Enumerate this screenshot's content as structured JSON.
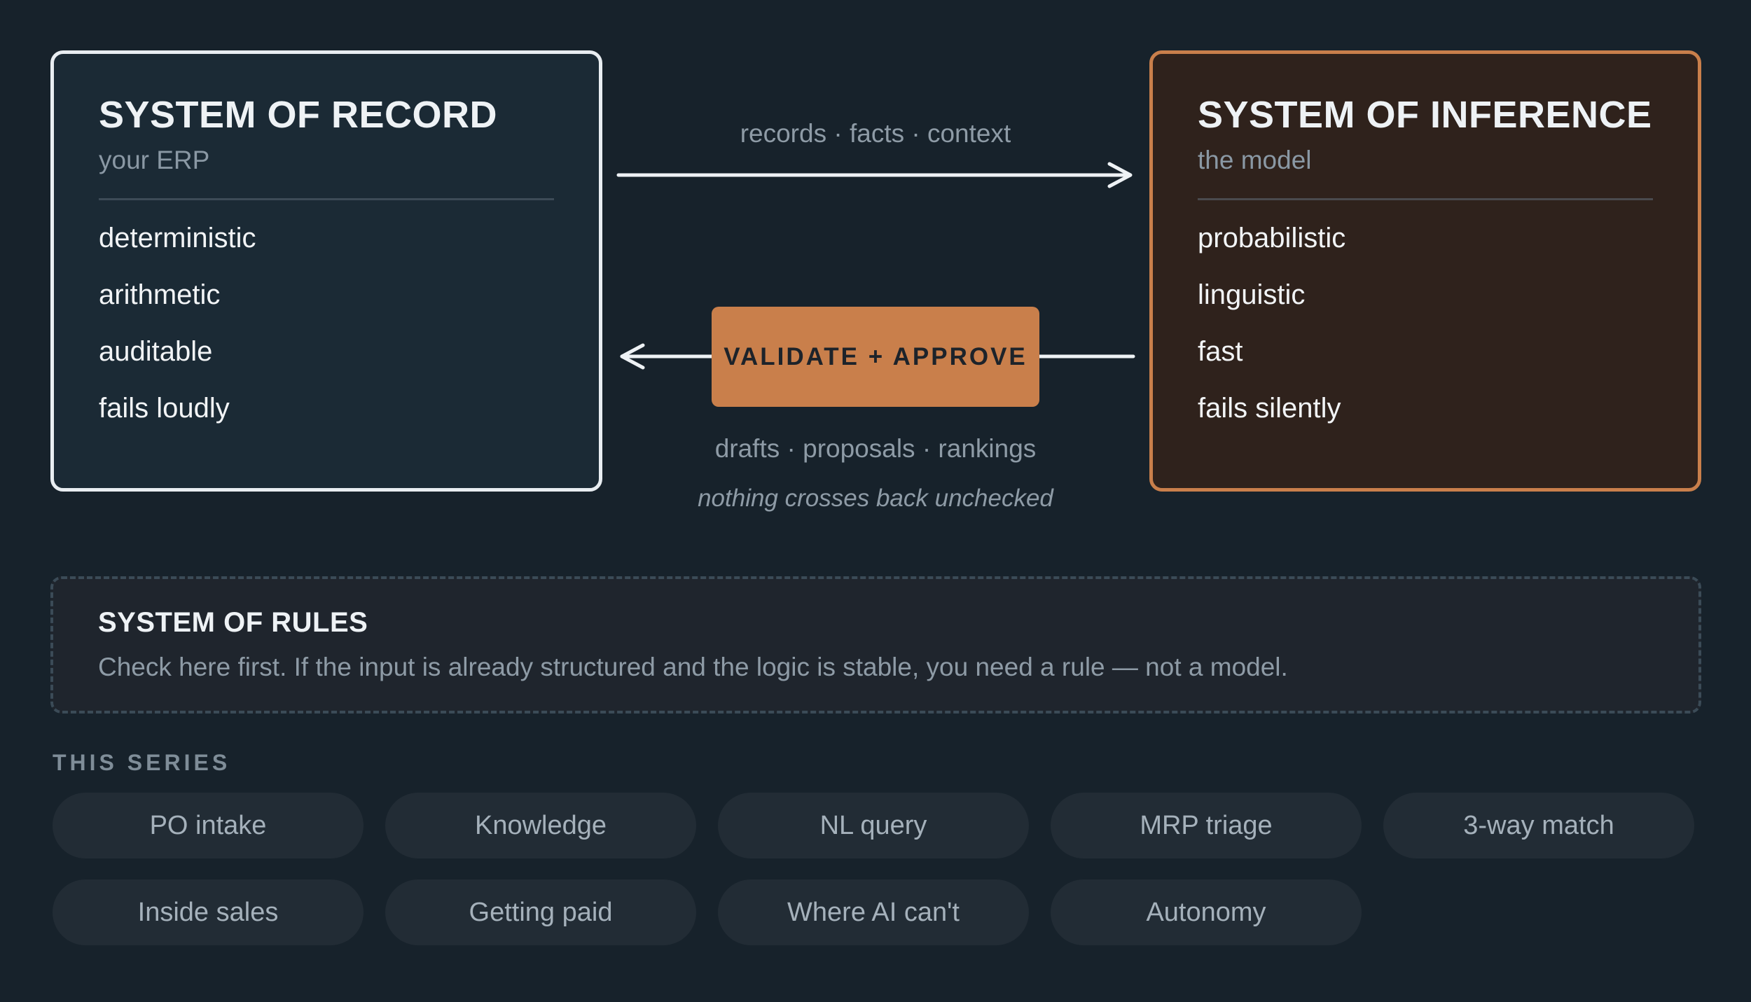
{
  "record": {
    "title": "SYSTEM OF RECORD",
    "subtitle": "your ERP",
    "traits": [
      "deterministic",
      "arithmetic",
      "auditable",
      "fails loudly"
    ]
  },
  "inference": {
    "title": "SYSTEM OF INFERENCE",
    "subtitle": "the model",
    "traits": [
      "probabilistic",
      "linguistic",
      "fast",
      "fails silently"
    ]
  },
  "flow": {
    "forward_label": "records · facts · context",
    "gate_label": "VALIDATE + APPROVE",
    "return_label": "drafts · proposals · rankings",
    "note": "nothing crosses back unchecked"
  },
  "rules": {
    "title": "SYSTEM OF RULES",
    "text": "Check here first. If the input is already structured and the logic is stable, you need a rule — not a model."
  },
  "series": {
    "label": "THIS SERIES",
    "items": [
      "PO intake",
      "Knowledge",
      "NL query",
      "MRP triage",
      "3-way match",
      "Inside sales",
      "Getting paid",
      "Where AI can't",
      "Autonomy"
    ]
  },
  "colors": {
    "background": "#17222b",
    "accent": "#c97f4b",
    "record_border": "#e8edf1",
    "inference_fill": "#2f221c"
  }
}
